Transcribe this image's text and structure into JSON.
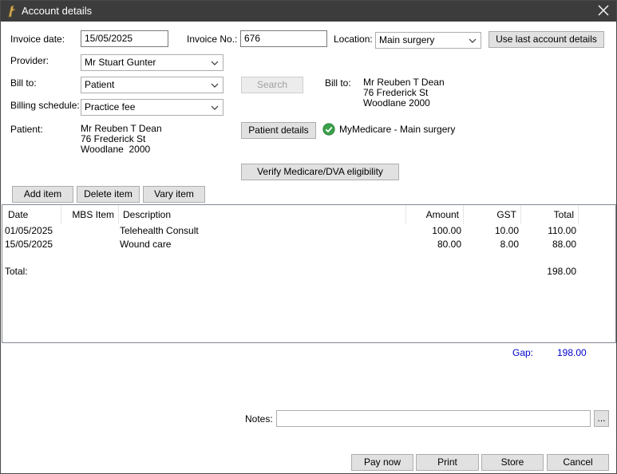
{
  "window": {
    "title": "Account details"
  },
  "labels": {
    "invoice_date": "Invoice date:",
    "invoice_no": "Invoice No.:",
    "location": "Location:",
    "provider": "Provider:",
    "bill_to": "Bill to:",
    "billing_schedule": "Billing schedule:",
    "patient": "Patient:",
    "bill_to_right": "Bill to:",
    "notes": "Notes:",
    "gap": "Gap:"
  },
  "fields": {
    "invoice_date": "15/05/2025",
    "invoice_no": "676",
    "location": "Main surgery",
    "provider": "Mr Stuart Gunter",
    "bill_to": "Patient",
    "billing_schedule": "Practice fee",
    "notes": ""
  },
  "patient": {
    "name": "Mr Reuben T Dean",
    "street": "76 Frederick St",
    "suburb": "Woodlane  2000"
  },
  "bill_to_address": {
    "name": "Mr Reuben T Dean",
    "street": "76 Frederick St",
    "suburb": "Woodlane 2000"
  },
  "medicare_status": "MyMedicare - Main surgery",
  "buttons": {
    "use_last": "Use last account details",
    "search": "Search",
    "patient_details": "Patient details",
    "verify": "Verify Medicare/DVA eligibility",
    "add_item": "Add item",
    "delete_item": "Delete item",
    "vary_item": "Vary item",
    "notes_more": "...",
    "pay_now": "Pay now",
    "print": "Print",
    "store": "Store",
    "cancel": "Cancel"
  },
  "table": {
    "columns": [
      "Date",
      "MBS Item",
      "Description",
      "Amount",
      "GST",
      "Total"
    ],
    "rows": [
      {
        "date": "01/05/2025",
        "mbs": "",
        "description": "Telehealth Consult",
        "amount": "100.00",
        "gst": "10.00",
        "total": "110.00"
      },
      {
        "date": "15/05/2025",
        "mbs": "",
        "description": "Wound care",
        "amount": "80.00",
        "gst": "8.00",
        "total": "88.00"
      }
    ],
    "total_label": "Total:",
    "total_value": "198.00"
  },
  "gap_value": "198.00",
  "colors": {
    "gap_text": "#0000cc",
    "titlebar": "#3c3c3c",
    "check_green": "#3aa04a"
  },
  "icons": {
    "app": "app-logo-icon",
    "close": "close-icon",
    "status": "green-check-icon",
    "dropdown": "chevron-down-icon"
  }
}
